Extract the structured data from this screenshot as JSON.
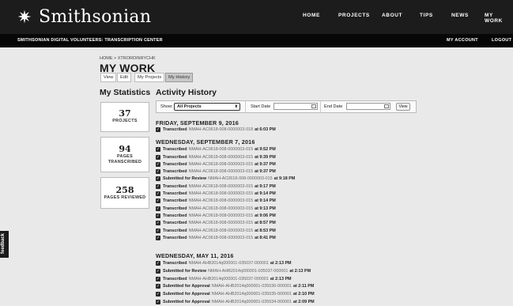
{
  "header": {
    "logo_text": "Smithsonian",
    "nav": [
      {
        "label": "HOME",
        "id": "home"
      },
      {
        "label": "PROJECTS",
        "id": "projects"
      },
      {
        "label": "ABOUT",
        "id": "about"
      },
      {
        "label": "TIPS",
        "id": "tips"
      },
      {
        "label": "NEWS",
        "id": "news"
      },
      {
        "label": "MY WORK",
        "id": "my-work"
      }
    ]
  },
  "subbar": {
    "title": "SMITHSONIAN DIGITAL VOLUNTEERS: TRANSCRIPTION CENTER",
    "my_account": "MY ACCOUNT",
    "logout": "LOGOUT"
  },
  "page": {
    "breadcrumb": "HOME > XTRORDINRYCHK",
    "title": "MY WORK",
    "tabs": [
      "View",
      "Edit",
      "My Projects",
      "My History"
    ],
    "active_tab": "My History"
  },
  "stats": {
    "heading": "My Statistics",
    "items": [
      {
        "value": "37",
        "label_lines": [
          "PROJECTS"
        ]
      },
      {
        "value": "94",
        "label_lines": [
          "PAGES",
          "TRANSCRIBED"
        ]
      },
      {
        "value": "258",
        "label_lines": [
          "PAGES REVIEWED"
        ]
      }
    ]
  },
  "history": {
    "heading": "Activity History",
    "filters": {
      "show_label": "Show:",
      "show_value": "All Projects",
      "start_label": "Start Date",
      "end_label": "End Date",
      "view_label": "View"
    },
    "groups": [
      {
        "date": "FRIDAY, SEPTEMBER 9, 2016",
        "entries": [
          {
            "action": "Transcribed",
            "id": "NMAH-AC0618-008-0000003-018",
            "time": "6:03 PM"
          }
        ]
      },
      {
        "date": "WEDNESDAY, SEPTEMBER 7, 2016",
        "entries": [
          {
            "action": "Transcribed",
            "id": "NMAH-AC0618-008-0000003-015",
            "time": "9:52 PM"
          },
          {
            "action": "Transcribed",
            "id": "NMAH-AC0618-008-0000003-015",
            "time": "9:39 PM"
          },
          {
            "action": "Transcribed",
            "id": "NMAH-AC0618-008-0000003-015",
            "time": "9:37 PM"
          },
          {
            "action": "Transcribed",
            "id": "NMAH-AC0618-008-0000003-015",
            "time": "9:37 PM"
          },
          {
            "action": "Submitted for Review",
            "id": "NMAH-AC0618-008-0000003-015",
            "time": "9:18 PM"
          },
          {
            "action": "Transcribed",
            "id": "NMAH-AC0618-008-0000003-015",
            "time": "9:17 PM"
          },
          {
            "action": "Transcribed",
            "id": "NMAH-AC0618-008-0000003-015",
            "time": "9:14 PM"
          },
          {
            "action": "Transcribed",
            "id": "NMAH-AC0618-008-0000003-015",
            "time": "9:14 PM"
          },
          {
            "action": "Transcribed",
            "id": "NMAH-AC0618-008-0000003-015",
            "time": "9:13 PM"
          },
          {
            "action": "Transcribed",
            "id": "NMAH-AC0618-008-0000003-015",
            "time": "9:06 PM"
          },
          {
            "action": "Transcribed",
            "id": "NMAH-AC0618-008-0000003-015",
            "time": "8:57 PM"
          },
          {
            "action": "Transcribed",
            "id": "NMAH-AC0618-008-0000003-015",
            "time": "8:53 PM"
          },
          {
            "action": "Transcribed",
            "id": "NMAH-AC0618-008-0000003-015",
            "time": "8:41 PM"
          }
        ]
      },
      {
        "date": "WEDNESDAY, MAY 11, 2016",
        "entries": [
          {
            "action": "Transcribed",
            "id": "NMAH-AHB2014q000001-035037-000001",
            "time": "2:13 PM"
          },
          {
            "action": "Submitted for Review",
            "id": "NMAH-AHB2014q000001-035037-000001",
            "time": "2:13 PM"
          },
          {
            "action": "Transcribed",
            "id": "NMAH-AHB2014q000001-035037-000001",
            "time": "2:13 PM"
          },
          {
            "action": "Submitted for Approval",
            "id": "NMAH-AHB2014q000001-035036-000001",
            "time": "2:11 PM"
          },
          {
            "action": "Submitted for Approval",
            "id": "NMAH-AHB2014q000001-035035-000001",
            "time": "2:10 PM"
          },
          {
            "action": "Submitted for Approval",
            "id": "NMAH-AHB2014q000001-035034-000001",
            "time": "2:09 PM"
          }
        ]
      }
    ]
  },
  "feedback_label": "feedback"
}
